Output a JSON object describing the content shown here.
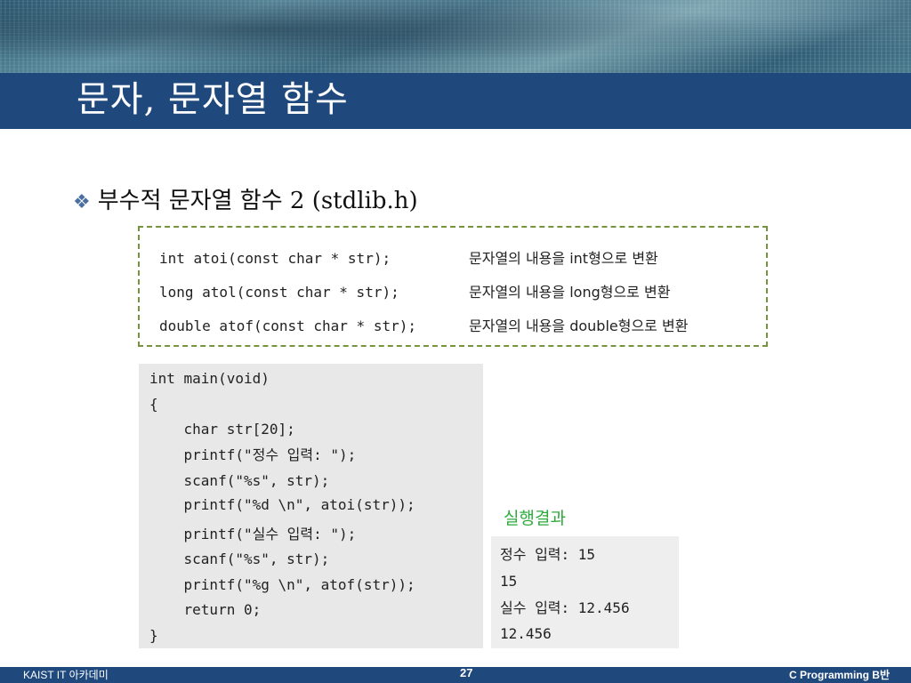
{
  "slide": {
    "title": "문자, 문자열 함수",
    "bullet": "부수적 문자열 함수 2 (stdlib.h)"
  },
  "prototypes": [
    {
      "code": "int atoi(const char * str);",
      "desc": "문자열의 내용을 int형으로 변환"
    },
    {
      "code": "long atol(const char * str);",
      "desc": "문자열의 내용을 long형으로 변환"
    },
    {
      "code": "double atof(const char * str);",
      "desc": "문자열의 내용을 double형으로 변환"
    }
  ],
  "code_lines": [
    "int main(void)",
    "{",
    "    char str[20];",
    "    printf(\"정수 입력: \");",
    "    scanf(\"%s\", str);",
    "    printf(\"%d \\n\", atoi(str));",
    "    printf(\"실수 입력: \");",
    "    scanf(\"%s\", str);",
    "    printf(\"%g \\n\", atof(str));",
    "    return 0;",
    "}"
  ],
  "result": {
    "label": "실행결과",
    "lines": [
      "정수 입력: 15",
      "15",
      "실수 입력: 12.456",
      "12.456"
    ]
  },
  "footer": {
    "left": "KAIST IT 아카데미",
    "page": "27",
    "right": "C Programming B반"
  }
}
